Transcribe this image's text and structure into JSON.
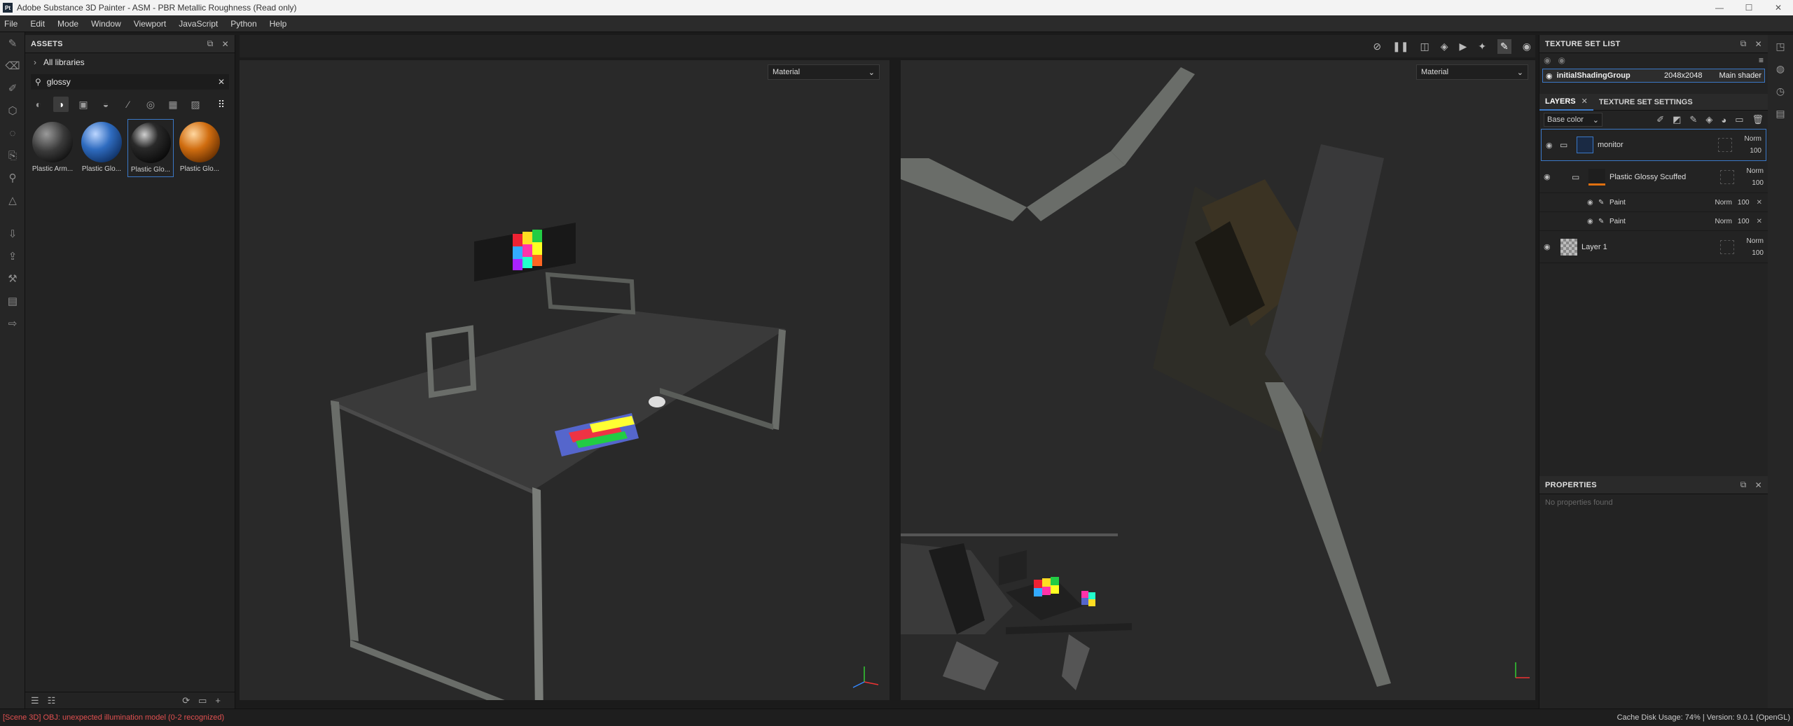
{
  "window": {
    "title": "Adobe Substance 3D Painter - ASM - PBR Metallic Roughness (Read only)",
    "app_icon": "Pt",
    "minimize": "—",
    "maximize": "☐",
    "close": "✕"
  },
  "menu": [
    "File",
    "Edit",
    "Mode",
    "Window",
    "Viewport",
    "JavaScript",
    "Python",
    "Help"
  ],
  "assets": {
    "title": "ASSETS",
    "libraries": "All libraries",
    "search_value": "glossy",
    "items": [
      {
        "label": "Plastic Arm...",
        "color": "#3a3a3a"
      },
      {
        "label": "Plastic Glo...",
        "color": "#2f6cc0"
      },
      {
        "label": "Plastic Glo...",
        "color": "#1a1a1a"
      },
      {
        "label": "Plastic Glo...",
        "color": "#d06d10"
      }
    ],
    "selected_index": 2
  },
  "viewports": {
    "left_mode": "Material",
    "right_mode": "Material"
  },
  "texture_set_list": {
    "title": "TEXTURE SET LIST",
    "item_name": "initialShadingGroup",
    "item_resolution": "2048x2048",
    "item_shader": "Main shader"
  },
  "layers_panel": {
    "tab_layers": "LAYERS",
    "tab_settings": "TEXTURE SET SETTINGS",
    "channel": "Base color",
    "layers": [
      {
        "name": "monitor",
        "blend": "Norm",
        "opacity": "100"
      },
      {
        "name": "Plastic Glossy Scuffed",
        "blend": "Norm",
        "opacity": "100"
      },
      {
        "name": "Layer 1",
        "blend": "Norm",
        "opacity": "100"
      }
    ],
    "sublayers": [
      {
        "name": "Paint",
        "blend": "Norm",
        "opacity": "100"
      },
      {
        "name": "Paint",
        "blend": "Norm",
        "opacity": "100"
      }
    ]
  },
  "properties": {
    "title": "PROPERTIES",
    "message": "No properties found"
  },
  "status": {
    "error": "[Scene 3D] OBJ: unexpected illumination model (0-2 recognized)",
    "disk": "Cache Disk Usage:   74% | Version: 9.0.1 (OpenGL)"
  }
}
